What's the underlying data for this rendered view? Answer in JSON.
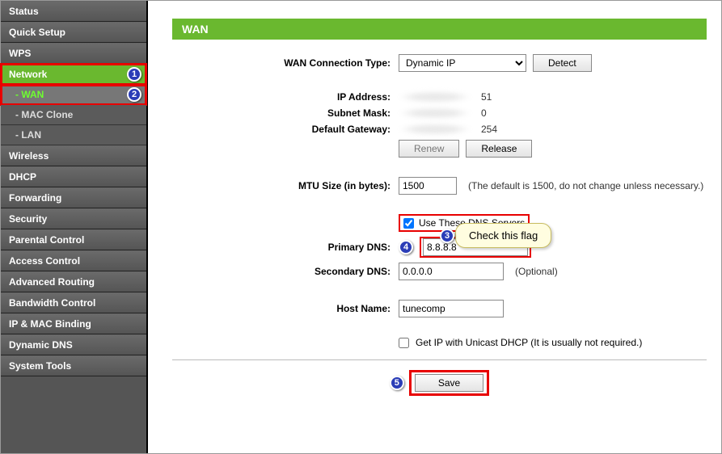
{
  "sidebar": {
    "items": [
      {
        "label": "Status"
      },
      {
        "label": "Quick Setup"
      },
      {
        "label": "WPS"
      },
      {
        "label": "Network"
      },
      {
        "label": "Wireless"
      },
      {
        "label": "DHCP"
      },
      {
        "label": "Forwarding"
      },
      {
        "label": "Security"
      },
      {
        "label": "Parental Control"
      },
      {
        "label": "Access Control"
      },
      {
        "label": "Advanced Routing"
      },
      {
        "label": "Bandwidth Control"
      },
      {
        "label": "IP & MAC Binding"
      },
      {
        "label": "Dynamic DNS"
      },
      {
        "label": "System Tools"
      }
    ],
    "sub": [
      {
        "label": "- WAN"
      },
      {
        "label": "- MAC Clone"
      },
      {
        "label": "- LAN"
      }
    ]
  },
  "page": {
    "title": "WAN",
    "conn_label": "WAN Connection Type:",
    "conn_value": "Dynamic IP",
    "detect": "Detect",
    "ip_label": "IP Address:",
    "ip_suffix": "51",
    "mask_label": "Subnet Mask:",
    "mask_suffix": "0",
    "gw_label": "Default Gateway:",
    "gw_suffix": "254",
    "renew": "Renew",
    "release": "Release",
    "mtu_label": "MTU Size (in bytes):",
    "mtu_value": "1500",
    "mtu_note": "(The default is 1500, do not change unless necessary.)",
    "use_dns": "Use These DNS Servers",
    "pdns_label": "Primary DNS:",
    "pdns_value": "8.8.8.8",
    "sdns_label": "Secondary DNS:",
    "sdns_value": "0.0.0.0",
    "optional": "(Optional)",
    "host_label": "Host Name:",
    "host_value": "tunecomp",
    "unicast": "Get IP with Unicast DHCP (It is usually not required.)",
    "save": "Save"
  },
  "annotations": {
    "n1": "1",
    "n2": "2",
    "n3": "3",
    "n4": "4",
    "n5": "5",
    "callout": "Check this flag"
  }
}
